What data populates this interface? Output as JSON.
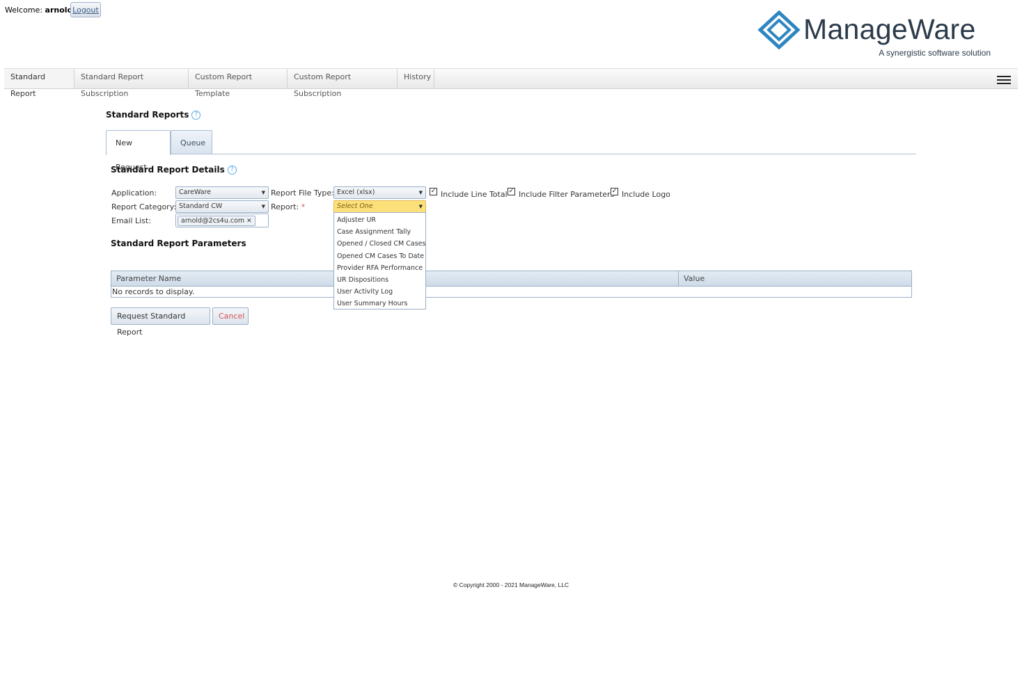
{
  "header": {
    "welcome_prefix": "Welcome:",
    "username": "arnold",
    "logout_label": "Logout",
    "logo_name": "ManageWare",
    "logo_tagline": "A synergistic software solution",
    "logo_color": "#2e86c1"
  },
  "menu": {
    "items": [
      {
        "label": "Standard Report"
      },
      {
        "label": "Standard Report Subscription"
      },
      {
        "label": "Custom Report Template"
      },
      {
        "label": "Custom Report Subscription"
      },
      {
        "label": "History"
      }
    ],
    "active_index": 0
  },
  "page": {
    "title": "Standard Reports",
    "tabs": [
      {
        "label": "New Request"
      },
      {
        "label": "Queue"
      }
    ],
    "details_heading": "Standard Report Details",
    "parameters_heading": "Standard Report Parameters"
  },
  "form": {
    "application_label": "Application:",
    "application_value": "CareWare",
    "report_category_label": "Report Category:",
    "report_category_value": "Standard CW",
    "email_list_label": "Email List:",
    "email_token": "arnold@2cs4u.com",
    "file_type_label": "Report File Type:",
    "file_type_value": "Excel (xlsx)",
    "report_label": "Report:",
    "required_mark": "*",
    "report_value": "Select One",
    "checkboxes": [
      {
        "label": "Include Line Total",
        "checked": true
      },
      {
        "label": "Include Filter Parameters",
        "checked": true
      },
      {
        "label": "Include Logo",
        "checked": true
      }
    ],
    "report_options": [
      "Adjuster UR",
      "Case Assignment Tally",
      "Opened / Closed CM Cases",
      "Opened CM Cases To Date",
      "Provider RFA Performance",
      "UR Dispositions",
      "User Activity Log",
      "User Summary Hours"
    ]
  },
  "grid": {
    "columns": [
      "Parameter Name",
      "Value"
    ],
    "empty_message": "No records to display."
  },
  "actions": {
    "request_label": "Request Standard Report",
    "cancel_label": "Cancel"
  },
  "footer": {
    "copyright": "© Copyright 2000 - 2021 ManageWare, LLC"
  }
}
